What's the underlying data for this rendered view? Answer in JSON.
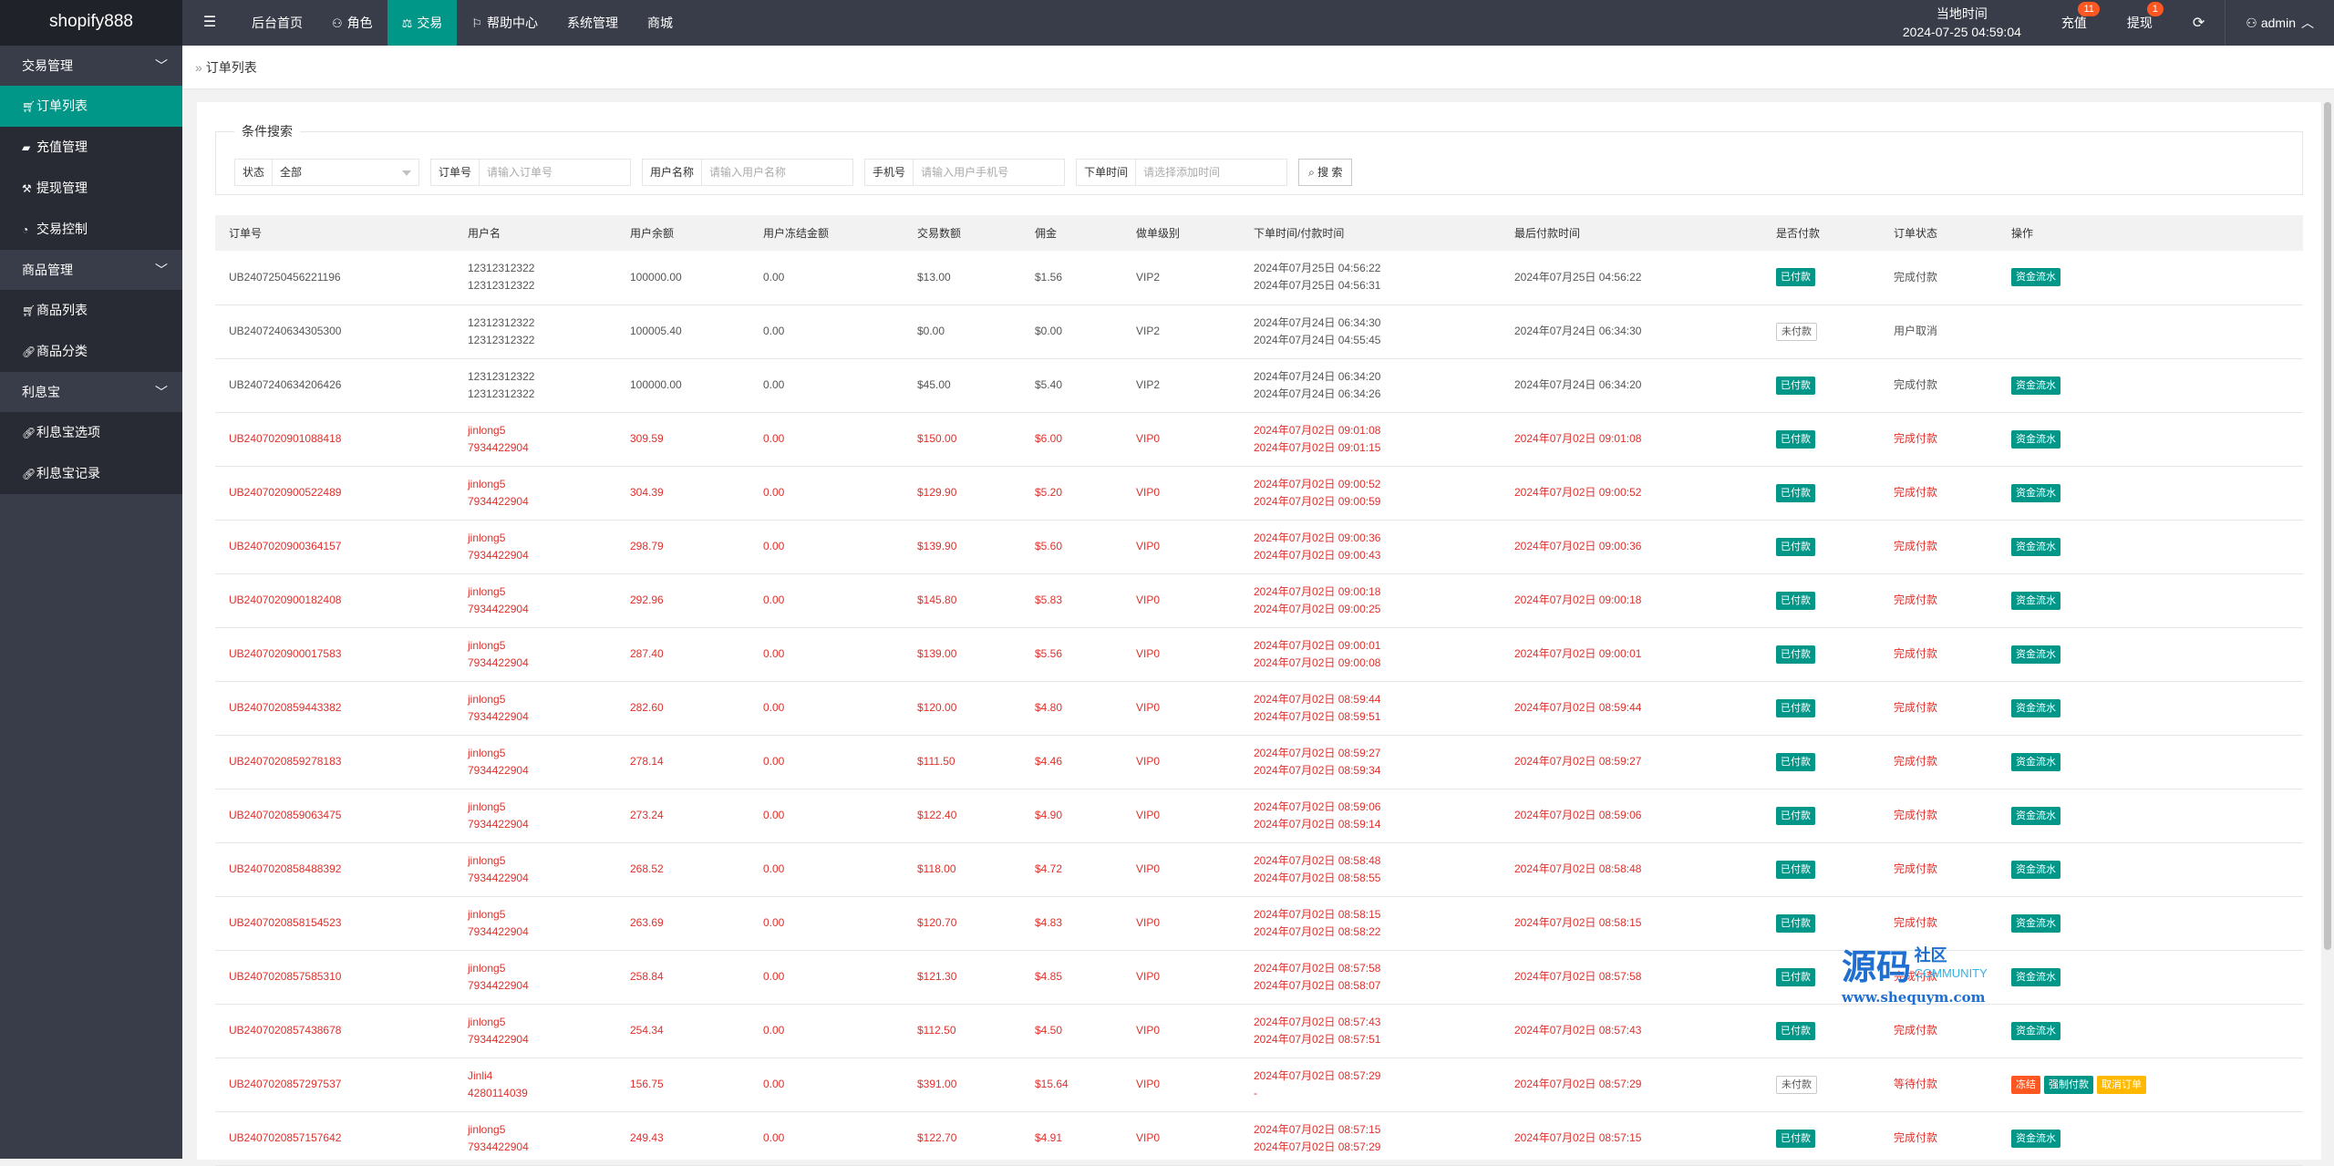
{
  "app": {
    "logo": "shopify888",
    "menu_icon": "☰"
  },
  "topnav": [
    {
      "label": "后台首页",
      "icon": ""
    },
    {
      "label": "角色",
      "icon": "user-icon"
    },
    {
      "label": "交易",
      "icon": "scale-icon",
      "active": true
    },
    {
      "label": "帮助中心",
      "icon": "flag-icon"
    },
    {
      "label": "系统管理",
      "icon": ""
    },
    {
      "label": "商城",
      "icon": ""
    }
  ],
  "header_right": {
    "time_label": "当地时间",
    "time_value": "2024-07-25 04:59:04",
    "recharge_label": "充值",
    "recharge_badge": "11",
    "withdraw_label": "提现",
    "withdraw_badge": "1",
    "refresh_icon": "refresh-icon",
    "user": "admin"
  },
  "sidebar": {
    "group1": "交易管理",
    "item_orders": "订单列表",
    "item_recharge": "充值管理",
    "item_withdraw": "提现管理",
    "item_trade_ctrl": "交易控制",
    "group2": "商品管理",
    "item_goods": "商品列表",
    "item_goods_cat": "商品分类",
    "group3": "利息宝",
    "item_interest_opt": "利息宝选项",
    "item_interest_rec": "利息宝记录"
  },
  "breadcrumb": "订单列表",
  "search": {
    "legend": "条件搜索",
    "status_label": "状态",
    "status_value": "全部",
    "order_label": "订单号",
    "order_placeholder": "请输入订单号",
    "username_label": "用户名称",
    "username_placeholder": "请输入用户名称",
    "phone_label": "手机号",
    "phone_placeholder": "请输入用户手机号",
    "time_label": "下单时间",
    "time_placeholder": "请选择添加时间",
    "button": "搜 索"
  },
  "table": {
    "headers": [
      "订单号",
      "用户名",
      "用户余额",
      "用户冻结金额",
      "交易数额",
      "佣金",
      "做单级别",
      "下单时间/付款时间",
      "最后付款时间",
      "是否付款",
      "订单状态",
      "操作"
    ],
    "rows": [
      {
        "id": "UB2407250456221196",
        "u1": "12312312322",
        "u2": "12312312322",
        "bal": "100000.00",
        "frozen": "0.00",
        "amt": "$13.00",
        "comm": "$1.56",
        "lvl": "VIP2",
        "t1": "2024年07月25日 04:56:22",
        "t2": "2024年07月25日 04:56:31",
        "last": "2024年07月25日 04:56:22",
        "paid": "已付款",
        "paid_style": "green",
        "status": "完成付款",
        "ops": [
          "资金流水"
        ],
        "red": false
      },
      {
        "id": "UB2407240634305300",
        "u1": "12312312322",
        "u2": "12312312322",
        "bal": "100005.40",
        "frozen": "0.00",
        "amt": "$0.00",
        "comm": "$0.00",
        "lvl": "VIP2",
        "t1": "2024年07月24日 06:34:30",
        "t2": "2024年07月24日 04:55:45",
        "last": "2024年07月24日 06:34:30",
        "paid": "未付款",
        "paid_style": "white",
        "status": "用户取消",
        "ops": [],
        "red": false
      },
      {
        "id": "UB2407240634206426",
        "u1": "12312312322",
        "u2": "12312312322",
        "bal": "100000.00",
        "frozen": "0.00",
        "amt": "$45.00",
        "comm": "$5.40",
        "lvl": "VIP2",
        "t1": "2024年07月24日 06:34:20",
        "t2": "2024年07月24日 06:34:26",
        "last": "2024年07月24日 06:34:20",
        "paid": "已付款",
        "paid_style": "green",
        "status": "完成付款",
        "ops": [
          "资金流水"
        ],
        "red": false
      },
      {
        "id": "UB2407020901088418",
        "u1": "jinlong5",
        "u2": "7934422904",
        "bal": "309.59",
        "frozen": "0.00",
        "amt": "$150.00",
        "comm": "$6.00",
        "lvl": "VIP0",
        "t1": "2024年07月02日 09:01:08",
        "t2": "2024年07月02日 09:01:15",
        "last": "2024年07月02日 09:01:08",
        "paid": "已付款",
        "paid_style": "green",
        "status": "完成付款",
        "ops": [
          "资金流水"
        ],
        "red": true
      },
      {
        "id": "UB2407020900522489",
        "u1": "jinlong5",
        "u2": "7934422904",
        "bal": "304.39",
        "frozen": "0.00",
        "amt": "$129.90",
        "comm": "$5.20",
        "lvl": "VIP0",
        "t1": "2024年07月02日 09:00:52",
        "t2": "2024年07月02日 09:00:59",
        "last": "2024年07月02日 09:00:52",
        "paid": "已付款",
        "paid_style": "green",
        "status": "完成付款",
        "ops": [
          "资金流水"
        ],
        "red": true
      },
      {
        "id": "UB2407020900364157",
        "u1": "jinlong5",
        "u2": "7934422904",
        "bal": "298.79",
        "frozen": "0.00",
        "amt": "$139.90",
        "comm": "$5.60",
        "lvl": "VIP0",
        "t1": "2024年07月02日 09:00:36",
        "t2": "2024年07月02日 09:00:43",
        "last": "2024年07月02日 09:00:36",
        "paid": "已付款",
        "paid_style": "green",
        "status": "完成付款",
        "ops": [
          "资金流水"
        ],
        "red": true
      },
      {
        "id": "UB2407020900182408",
        "u1": "jinlong5",
        "u2": "7934422904",
        "bal": "292.96",
        "frozen": "0.00",
        "amt": "$145.80",
        "comm": "$5.83",
        "lvl": "VIP0",
        "t1": "2024年07月02日 09:00:18",
        "t2": "2024年07月02日 09:00:25",
        "last": "2024年07月02日 09:00:18",
        "paid": "已付款",
        "paid_style": "green",
        "status": "完成付款",
        "ops": [
          "资金流水"
        ],
        "red": true
      },
      {
        "id": "UB2407020900017583",
        "u1": "jinlong5",
        "u2": "7934422904",
        "bal": "287.40",
        "frozen": "0.00",
        "amt": "$139.00",
        "comm": "$5.56",
        "lvl": "VIP0",
        "t1": "2024年07月02日 09:00:01",
        "t2": "2024年07月02日 09:00:08",
        "last": "2024年07月02日 09:00:01",
        "paid": "已付款",
        "paid_style": "green",
        "status": "完成付款",
        "ops": [
          "资金流水"
        ],
        "red": true
      },
      {
        "id": "UB2407020859443382",
        "u1": "jinlong5",
        "u2": "7934422904",
        "bal": "282.60",
        "frozen": "0.00",
        "amt": "$120.00",
        "comm": "$4.80",
        "lvl": "VIP0",
        "t1": "2024年07月02日 08:59:44",
        "t2": "2024年07月02日 08:59:51",
        "last": "2024年07月02日 08:59:44",
        "paid": "已付款",
        "paid_style": "green",
        "status": "完成付款",
        "ops": [
          "资金流水"
        ],
        "red": true
      },
      {
        "id": "UB2407020859278183",
        "u1": "jinlong5",
        "u2": "7934422904",
        "bal": "278.14",
        "frozen": "0.00",
        "amt": "$111.50",
        "comm": "$4.46",
        "lvl": "VIP0",
        "t1": "2024年07月02日 08:59:27",
        "t2": "2024年07月02日 08:59:34",
        "last": "2024年07月02日 08:59:27",
        "paid": "已付款",
        "paid_style": "green",
        "status": "完成付款",
        "ops": [
          "资金流水"
        ],
        "red": true
      },
      {
        "id": "UB2407020859063475",
        "u1": "jinlong5",
        "u2": "7934422904",
        "bal": "273.24",
        "frozen": "0.00",
        "amt": "$122.40",
        "comm": "$4.90",
        "lvl": "VIP0",
        "t1": "2024年07月02日 08:59:06",
        "t2": "2024年07月02日 08:59:14",
        "last": "2024年07月02日 08:59:06",
        "paid": "已付款",
        "paid_style": "green",
        "status": "完成付款",
        "ops": [
          "资金流水"
        ],
        "red": true
      },
      {
        "id": "UB2407020858488392",
        "u1": "jinlong5",
        "u2": "7934422904",
        "bal": "268.52",
        "frozen": "0.00",
        "amt": "$118.00",
        "comm": "$4.72",
        "lvl": "VIP0",
        "t1": "2024年07月02日 08:58:48",
        "t2": "2024年07月02日 08:58:55",
        "last": "2024年07月02日 08:58:48",
        "paid": "已付款",
        "paid_style": "green",
        "status": "完成付款",
        "ops": [
          "资金流水"
        ],
        "red": true
      },
      {
        "id": "UB2407020858154523",
        "u1": "jinlong5",
        "u2": "7934422904",
        "bal": "263.69",
        "frozen": "0.00",
        "amt": "$120.70",
        "comm": "$4.83",
        "lvl": "VIP0",
        "t1": "2024年07月02日 08:58:15",
        "t2": "2024年07月02日 08:58:22",
        "last": "2024年07月02日 08:58:15",
        "paid": "已付款",
        "paid_style": "green",
        "status": "完成付款",
        "ops": [
          "资金流水"
        ],
        "red": true
      },
      {
        "id": "UB2407020857585310",
        "u1": "jinlong5",
        "u2": "7934422904",
        "bal": "258.84",
        "frozen": "0.00",
        "amt": "$121.30",
        "comm": "$4.85",
        "lvl": "VIP0",
        "t1": "2024年07月02日 08:57:58",
        "t2": "2024年07月02日 08:58:07",
        "last": "2024年07月02日 08:57:58",
        "paid": "已付款",
        "paid_style": "green",
        "status": "完成付款",
        "ops": [
          "资金流水"
        ],
        "red": true
      },
      {
        "id": "UB2407020857438678",
        "u1": "jinlong5",
        "u2": "7934422904",
        "bal": "254.34",
        "frozen": "0.00",
        "amt": "$112.50",
        "comm": "$4.50",
        "lvl": "VIP0",
        "t1": "2024年07月02日 08:57:43",
        "t2": "2024年07月02日 08:57:51",
        "last": "2024年07月02日 08:57:43",
        "paid": "已付款",
        "paid_style": "green",
        "status": "完成付款",
        "ops": [
          "资金流水"
        ],
        "red": true
      },
      {
        "id": "UB2407020857297537",
        "u1": "Jinli4",
        "u2": "4280114039",
        "bal": "156.75",
        "frozen": "0.00",
        "amt": "$391.00",
        "comm": "$15.64",
        "lvl": "VIP0",
        "t1": "2024年07月02日 08:57:29",
        "t2": "-",
        "last": "2024年07月02日 08:57:29",
        "paid": "未付款",
        "paid_style": "white",
        "status": "等待付款",
        "ops": [
          "冻结",
          "强制付款",
          "取消订单"
        ],
        "red": true
      },
      {
        "id": "UB2407020857157642",
        "u1": "jinlong5",
        "u2": "7934422904",
        "bal": "249.43",
        "frozen": "0.00",
        "amt": "$122.70",
        "comm": "$4.91",
        "lvl": "VIP0",
        "t1": "2024年07月02日 08:57:15",
        "t2": "2024年07月02日 08:57:29",
        "last": "2024年07月02日 08:57:15",
        "paid": "已付款",
        "paid_style": "green",
        "status": "完成付款",
        "ops": [
          "资金流水"
        ],
        "red": true
      }
    ]
  },
  "watermark": {
    "big": "源码",
    "small": "社区",
    "en": "COMMUNITY",
    "url": "www.shequym.com"
  }
}
